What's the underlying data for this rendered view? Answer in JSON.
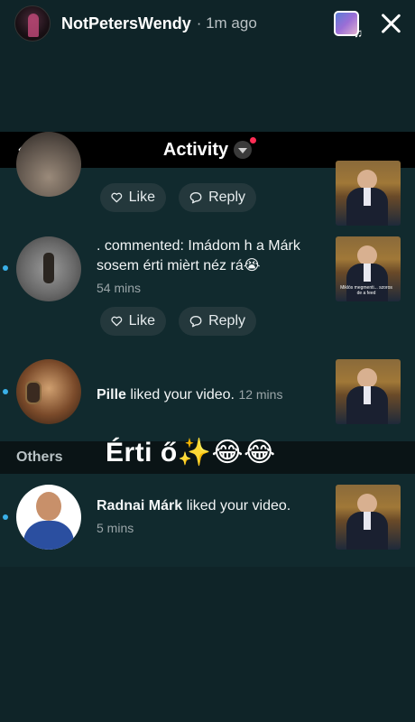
{
  "story": {
    "username": "NotPetersWendy",
    "time_ago": "· 1m ago"
  },
  "activity": {
    "title": "Activity"
  },
  "notifications": [
    {
      "actions": {
        "like": "Like",
        "reply": "Reply"
      }
    },
    {
      "text": ". commented: Imádom h a Márk sosem érti mièrt néz rá😭",
      "time": "54 mins",
      "actions": {
        "like": "Like",
        "reply": "Reply"
      }
    },
    {
      "name": "Pille",
      "text": "liked your video.",
      "time": "12 mins"
    }
  ],
  "others": {
    "label": "Others",
    "notification": {
      "name": "Radnai Márk",
      "text": "liked your video.",
      "time": "5 mins"
    }
  },
  "overlay_caption": "Érti ő✨😂😂",
  "thumb_caption": "Miklós megmenti... szoros de a feed"
}
